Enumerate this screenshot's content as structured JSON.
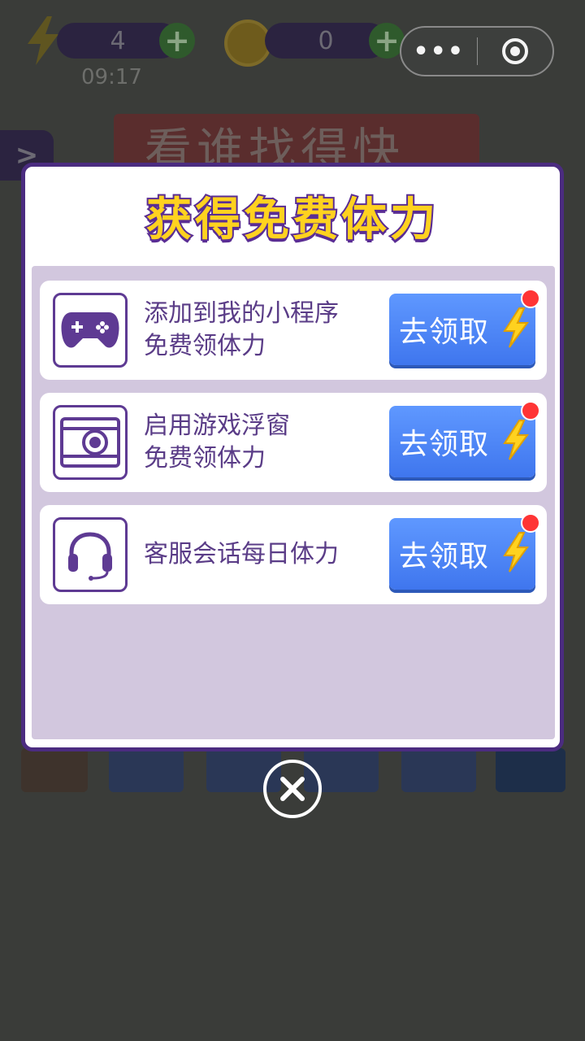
{
  "hud": {
    "energy_count": "4",
    "timer": "09:17",
    "coin_count": "0",
    "plus": "+"
  },
  "mini_program_capsule": {
    "more": "•••"
  },
  "background": {
    "back_arrow": ">",
    "game_title": "看谁找得快"
  },
  "modal": {
    "title": "获得免费体力",
    "rows": [
      {
        "line1": "添加到我的小程序",
        "line2": "免费领体力",
        "button": "去领取",
        "icon": "gamepad-icon"
      },
      {
        "line1": "启用游戏浮窗",
        "line2": "免费领体力",
        "button": "去领取",
        "icon": "floating-window-icon"
      },
      {
        "line1": "客服会话每日体力",
        "line2": "",
        "button": "去领取",
        "icon": "headset-icon"
      }
    ]
  },
  "colors": {
    "accent_purple": "#5a3c87",
    "button_blue": "#4a84f5",
    "title_yellow": "#ffd21f",
    "panel_lilac": "#d2c7de"
  }
}
